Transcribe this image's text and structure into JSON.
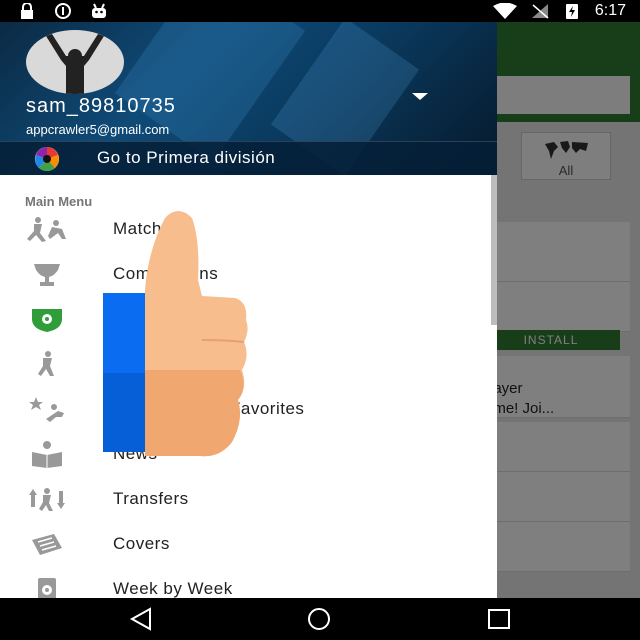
{
  "status_bar": {
    "time": "6:17",
    "left_icons": [
      "lock-icon",
      "cast-icon",
      "android-icon"
    ],
    "right_icons": [
      "wifi-icon",
      "no-signal-icon",
      "battery-charging-icon"
    ]
  },
  "background_app": {
    "tile_label": "All",
    "install_label": "INSTALL",
    "ad_text": "layer\nime! Joi..."
  },
  "drawer": {
    "username": "sam_89810735",
    "email": "appcrawler5@gmail.com",
    "goto_label": "Go to Primera división",
    "section_title": "Main Menu",
    "items": [
      {
        "label": "Matches",
        "icon": "players-icon"
      },
      {
        "label": "Competitions",
        "icon": "trophy-icon"
      },
      {
        "label": "",
        "icon": "league-badge-icon"
      },
      {
        "label": "",
        "icon": "player-icon"
      },
      {
        "label": "Favorites",
        "icon": "star-player-icon"
      },
      {
        "label": "News",
        "icon": "news-reader-icon"
      },
      {
        "label": "Transfers",
        "icon": "transfers-icon"
      },
      {
        "label": "Covers",
        "icon": "newspaper-icon"
      },
      {
        "label": "Week by Week",
        "icon": "calendar-ball-icon"
      }
    ]
  },
  "colors": {
    "primary_green": "#2e7d32",
    "overlay_blue": "#0a6cf0",
    "thumb_skin": "#f8b888"
  },
  "nav_bar": {
    "buttons": [
      "back-icon",
      "home-icon",
      "recents-icon"
    ]
  }
}
